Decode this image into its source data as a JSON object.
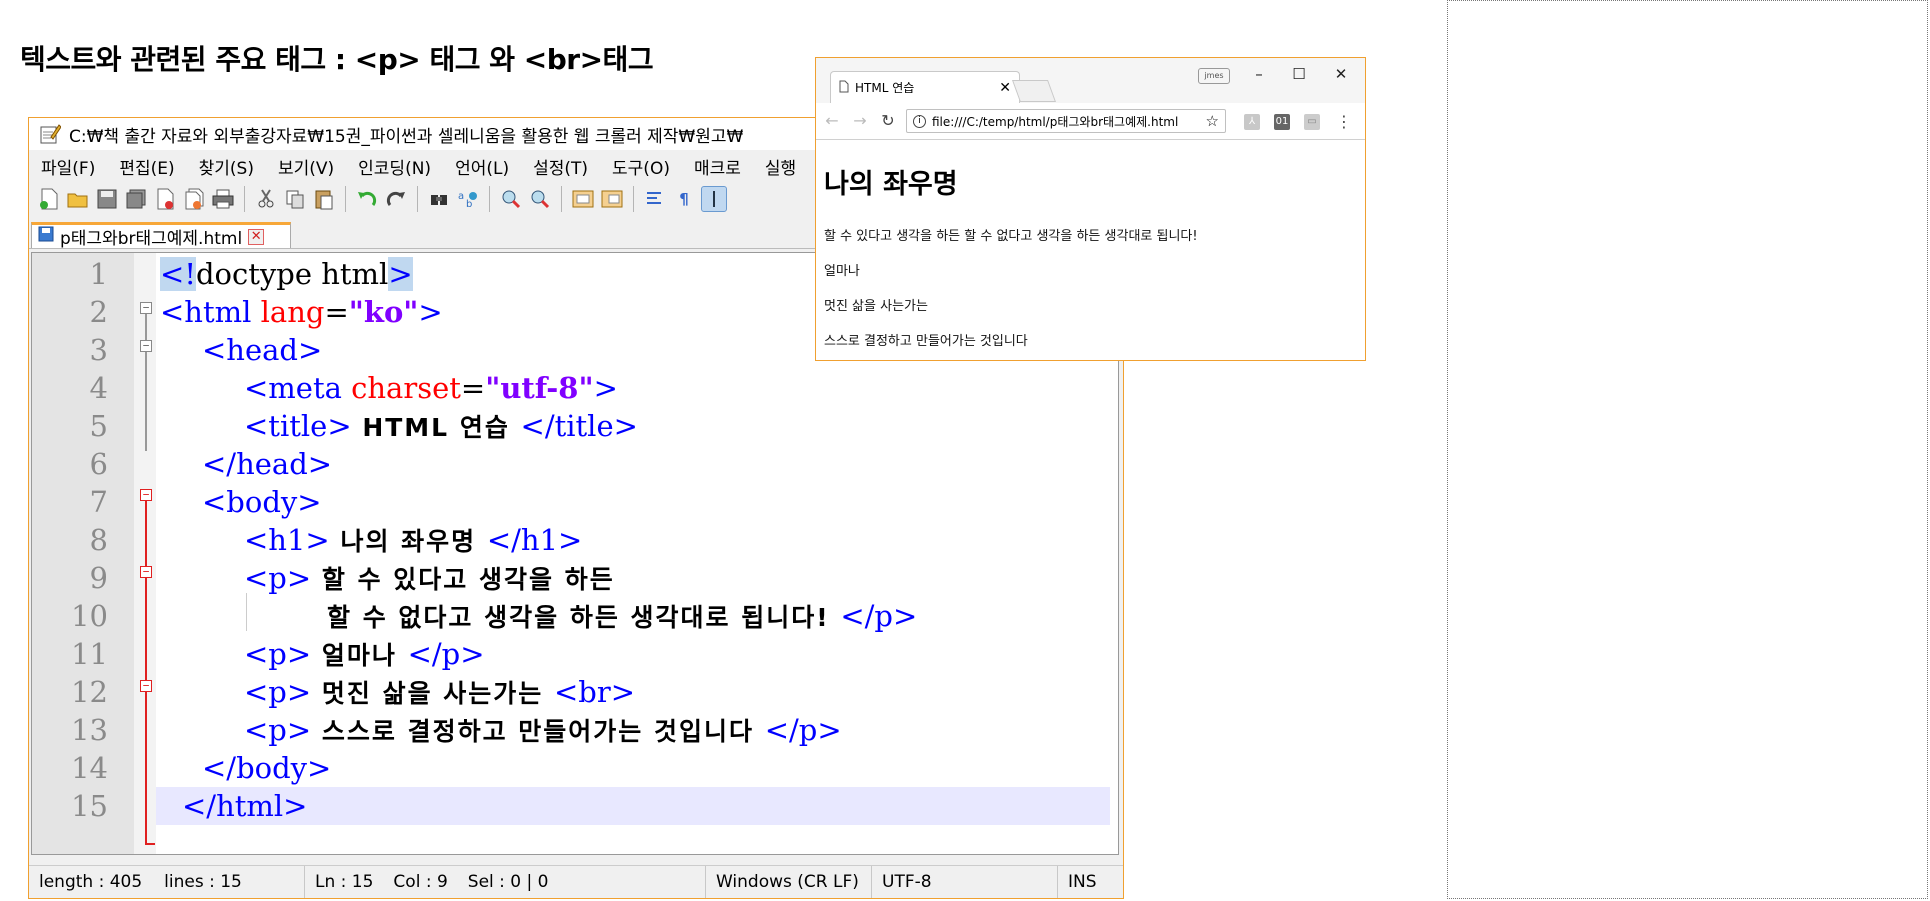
{
  "slide": {
    "title": "텍스트와 관련된 주요 태그 : <p> 태그 와 <br>태그"
  },
  "notepad": {
    "window_title": "C:₩책 출간 자료와 외부출강자료₩15권_파이썬과 셀레니움을 활용한 웹 크롤러 제작₩원고₩",
    "menu": [
      "파일(F)",
      "편집(E)",
      "찾기(S)",
      "보기(V)",
      "인코딩(N)",
      "언어(L)",
      "설정(T)",
      "도구(O)",
      "매크로",
      "실행"
    ],
    "tab": {
      "label": "p태그와br태그예제.html",
      "close": "✕"
    },
    "line_numbers": [
      "1",
      "2",
      "3",
      "4",
      "5",
      "6",
      "7",
      "8",
      "9",
      "10",
      "11",
      "12",
      "13",
      "14",
      "15"
    ],
    "code": {
      "l1": {
        "a": "<",
        "b": "!",
        "c": "doctype html",
        "d": ">"
      },
      "l2": {
        "open": "<html ",
        "attr": "lang",
        "eq": "=",
        "val": "\"ko\"",
        "close": ">"
      },
      "l3": {
        "tag": "<head>"
      },
      "l4": {
        "open": "<meta ",
        "attr": "charset",
        "eq": "=",
        "val": "\"utf-8\"",
        "close": ">"
      },
      "l5": {
        "open": "<title>",
        "text": " HTML 연습 ",
        "close": "</title>"
      },
      "l6": {
        "tag": "</head>"
      },
      "l7": {
        "tag": "<body>"
      },
      "l8": {
        "open": "<h1>",
        "text": " 나의 좌우명 ",
        "close": "</h1>"
      },
      "l9": {
        "open": "<p>",
        "text": " 할 수 있다고 생각을 하든"
      },
      "l10": {
        "text": "할 수 없다고 생각을 하든 생각대로 됩니다! ",
        "close": "</p>"
      },
      "l11": {
        "open": "<p>",
        "text": " 얼마나 ",
        "close": "</p>"
      },
      "l12": {
        "open": "<p>",
        "text": " 멋진 삶을 사는가는 ",
        "close": "<br>"
      },
      "l13": {
        "open": "<p>",
        "text": " 스스로 결정하고 만들어가는 것입니다 ",
        "close": "</p>"
      },
      "l14": {
        "tag": "</body>"
      },
      "l15": {
        "tag": "</html>"
      }
    },
    "status": {
      "length": "length : 405",
      "lines": "lines : 15",
      "ln": "Ln : 15",
      "col": "Col : 9",
      "sel": "Sel : 0 | 0",
      "eol": "Windows (CR LF)",
      "encoding": "UTF-8",
      "mode": "INS"
    }
  },
  "chrome": {
    "tab_title": "HTML 연습",
    "tab_close": "✕",
    "profile": "jmes",
    "url": "file:///C:/temp/html/p태그와br태그예제.html",
    "ext_label": "01",
    "page": {
      "h1": "나의 좌우명",
      "p1": "할 수 있다고 생각을 하든 할 수 없다고 생각을 하든 생각대로 됩니다!",
      "p2": "얼마나",
      "p3": "멋진 삶을 사는가는",
      "p4": "스스로 결정하고 만들어가는 것입니다"
    }
  },
  "colors": {
    "tag": "#0000ff",
    "attr": "#ff0000",
    "value": "#8000ff",
    "window_border": "#f0a030",
    "current_line": "#e8e8ff"
  }
}
